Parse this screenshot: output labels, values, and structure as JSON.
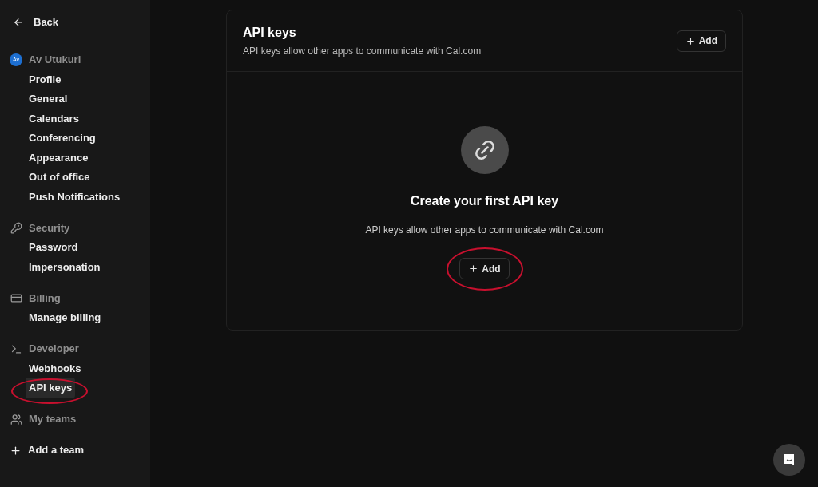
{
  "sidebar": {
    "back": "Back",
    "sections": [
      {
        "kind": "avatar",
        "initials": "Av",
        "title": "Av Utukuri",
        "items": [
          {
            "label": "Profile",
            "selected": false
          },
          {
            "label": "General",
            "selected": false
          },
          {
            "label": "Calendars",
            "selected": false
          },
          {
            "label": "Conferencing",
            "selected": false
          },
          {
            "label": "Appearance",
            "selected": false
          },
          {
            "label": "Out of office",
            "selected": false
          },
          {
            "label": "Push Notifications",
            "selected": false
          }
        ]
      },
      {
        "kind": "key",
        "title": "Security",
        "items": [
          {
            "label": "Password",
            "selected": false
          },
          {
            "label": "Impersonation",
            "selected": false
          }
        ]
      },
      {
        "kind": "card",
        "title": "Billing",
        "items": [
          {
            "label": "Manage billing",
            "selected": false
          }
        ]
      },
      {
        "kind": "terminal",
        "title": "Developer",
        "items": [
          {
            "label": "Webhooks",
            "selected": false
          },
          {
            "label": "API keys",
            "selected": true
          }
        ]
      },
      {
        "kind": "users",
        "title": "My teams"
      }
    ],
    "add_team": "Add a team"
  },
  "card": {
    "title": "API keys",
    "subtitle": "API keys allow other apps to communicate with Cal.com",
    "add_button": "Add",
    "empty": {
      "heading": "Create your first API key",
      "text": "API keys allow other apps to communicate with Cal.com",
      "add_button": "Add"
    }
  }
}
